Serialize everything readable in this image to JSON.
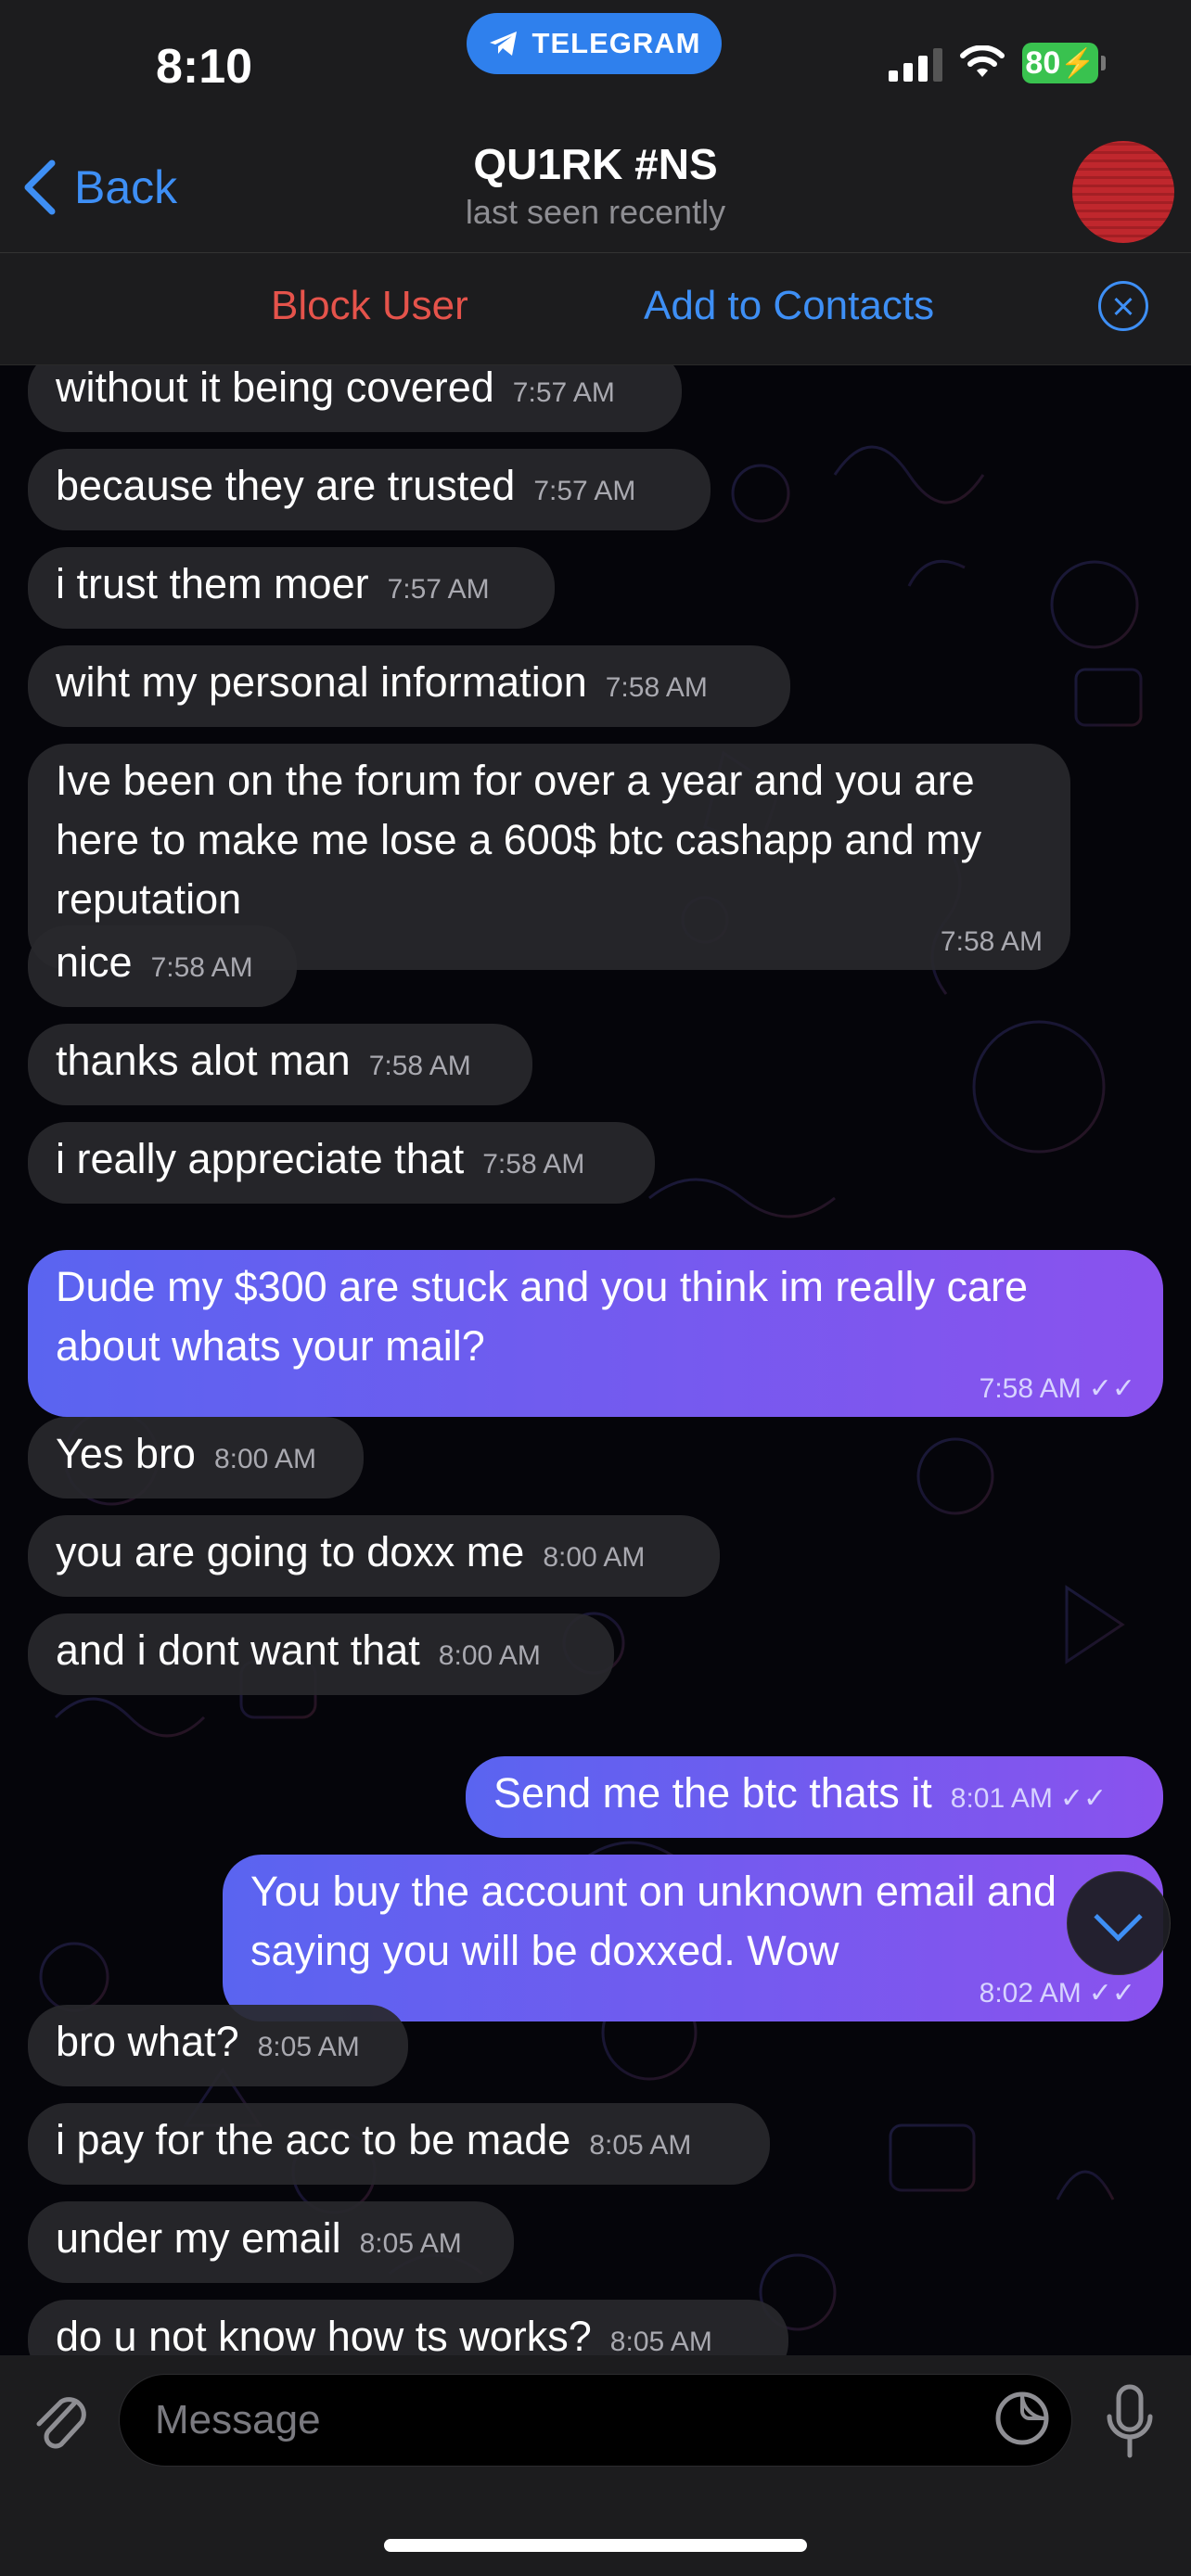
{
  "status_bar": {
    "time": "8:10",
    "app_pill": "TELEGRAM",
    "battery": "80"
  },
  "header": {
    "back_label": "Back",
    "title": "QU1RK #NS",
    "subtitle": "last seen recently"
  },
  "actions": {
    "block": "Block User",
    "add": "Add to Contacts"
  },
  "messages": [
    {
      "dir": "in",
      "text": "without it being covered",
      "time": "7:57 AM"
    },
    {
      "dir": "in",
      "text": "because they are trusted",
      "time": "7:57 AM"
    },
    {
      "dir": "in",
      "text": "i trust them moer",
      "time": "7:57 AM"
    },
    {
      "dir": "in",
      "text": "wiht my personal information",
      "time": "7:58 AM"
    },
    {
      "dir": "in",
      "text": "Ive been on the forum for over a year and you are here to make me lose a 600$ btc cashapp and my reputation",
      "time": "7:58 AM"
    },
    {
      "dir": "in",
      "text": "nice",
      "time": "7:58 AM"
    },
    {
      "dir": "in",
      "text": "thanks alot man",
      "time": "7:58 AM"
    },
    {
      "dir": "in",
      "text": "i really appreciate that",
      "time": "7:58 AM"
    },
    {
      "dir": "out",
      "text": "Dude my $300 are stuck and you think im really care about whats your mail?",
      "time": "7:58 AM"
    },
    {
      "dir": "in",
      "text": "Yes bro",
      "time": "8:00 AM"
    },
    {
      "dir": "in",
      "text": "you are going to doxx me",
      "time": "8:00 AM"
    },
    {
      "dir": "in",
      "text": "and i dont want that",
      "time": "8:00 AM"
    },
    {
      "dir": "out",
      "text": "Send me the btc thats it",
      "time": "8:01 AM"
    },
    {
      "dir": "out",
      "text": "You buy the account on unknown email and saying you will be doxxed. Wow",
      "time": "8:02 AM"
    },
    {
      "dir": "in",
      "text": "bro what?",
      "time": "8:05 AM"
    },
    {
      "dir": "in",
      "text": "i pay for the acc to be made",
      "time": "8:05 AM"
    },
    {
      "dir": "in",
      "text": "under my email",
      "time": "8:05 AM"
    },
    {
      "dir": "in",
      "text": "do u not know how ts works?",
      "time": "8:05 AM"
    }
  ],
  "composer": {
    "placeholder": "Message"
  },
  "colors": {
    "accent": "#3e8ff5",
    "danger": "#e5534b",
    "outgoing_from": "#5a64f0",
    "outgoing_to": "#8a52ee"
  }
}
